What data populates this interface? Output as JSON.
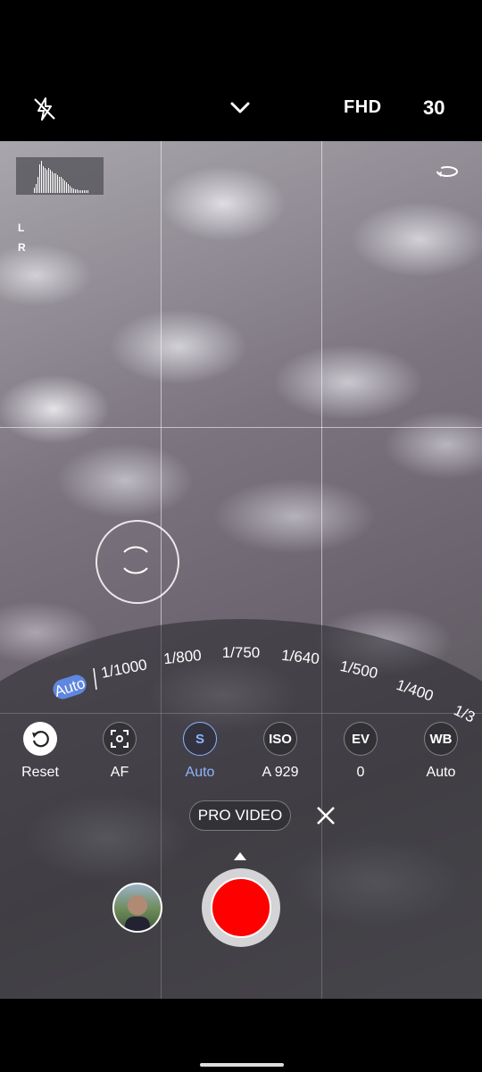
{
  "top_bar": {
    "flash_icon": "flash-off-icon",
    "chevron_icon": "chevron-down-icon",
    "resolution": "FHD",
    "frame_rate": "30"
  },
  "viewfinder": {
    "audio_levels": [
      "L",
      "R"
    ],
    "rotate_icon": "rotate-camera-icon"
  },
  "shutter_dial": {
    "current": "Auto",
    "speeds": [
      "1/1000",
      "1/800",
      "1/750",
      "1/640",
      "1/500",
      "1/400",
      "1/3"
    ]
  },
  "modes": [
    {
      "icon": "reset-icon",
      "label": "Reset"
    },
    {
      "icon_text": "[o]",
      "label": "AF"
    },
    {
      "icon_text": "S",
      "label": "Auto"
    },
    {
      "icon_text": "ISO",
      "label": "A 929"
    },
    {
      "icon_text": "EV",
      "label": "0"
    },
    {
      "icon_text": "WB",
      "label": "Auto"
    }
  ],
  "mode_name": "PRO VIDEO",
  "colors": {
    "record": "#ff0000",
    "accent": "#8fb4ff"
  }
}
